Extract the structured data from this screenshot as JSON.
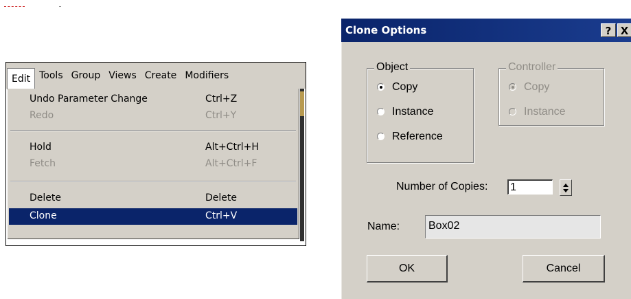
{
  "menubar": {
    "items": [
      "Edit",
      "Tools",
      "Group",
      "Views",
      "Create",
      "Modifiers"
    ]
  },
  "edit_menu": {
    "items": [
      {
        "label": "Undo Parameter Change",
        "shortcut": "Ctrl+Z",
        "enabled": true
      },
      {
        "label": "Redo",
        "shortcut": "Ctrl+Y",
        "enabled": false
      },
      {
        "label": "Hold",
        "shortcut": "Alt+Ctrl+H",
        "enabled": true
      },
      {
        "label": "Fetch",
        "shortcut": "Alt+Ctrl+F",
        "enabled": false
      },
      {
        "label": "Delete",
        "shortcut": "Delete",
        "enabled": true
      },
      {
        "label": "Clone",
        "shortcut": "Ctrl+V",
        "enabled": true,
        "selected": true
      }
    ]
  },
  "dialog": {
    "title": "Clone Options",
    "help_label": "?",
    "close_label": "X",
    "object_group": {
      "legend": "Object",
      "options": [
        "Copy",
        "Instance",
        "Reference"
      ],
      "selected": "Copy"
    },
    "controller_group": {
      "legend": "Controller",
      "options": [
        "Copy",
        "Instance"
      ],
      "selected": "Copy",
      "enabled": false
    },
    "copies_label": "Number of Copies:",
    "copies_value": "1",
    "name_label": "Name:",
    "name_value": "Box02",
    "ok_label": "OK",
    "cancel_label": "Cancel"
  },
  "colors": {
    "selection": "#0a246a",
    "face": "#d4d0c8",
    "disabled_text": "#8f8c86"
  }
}
